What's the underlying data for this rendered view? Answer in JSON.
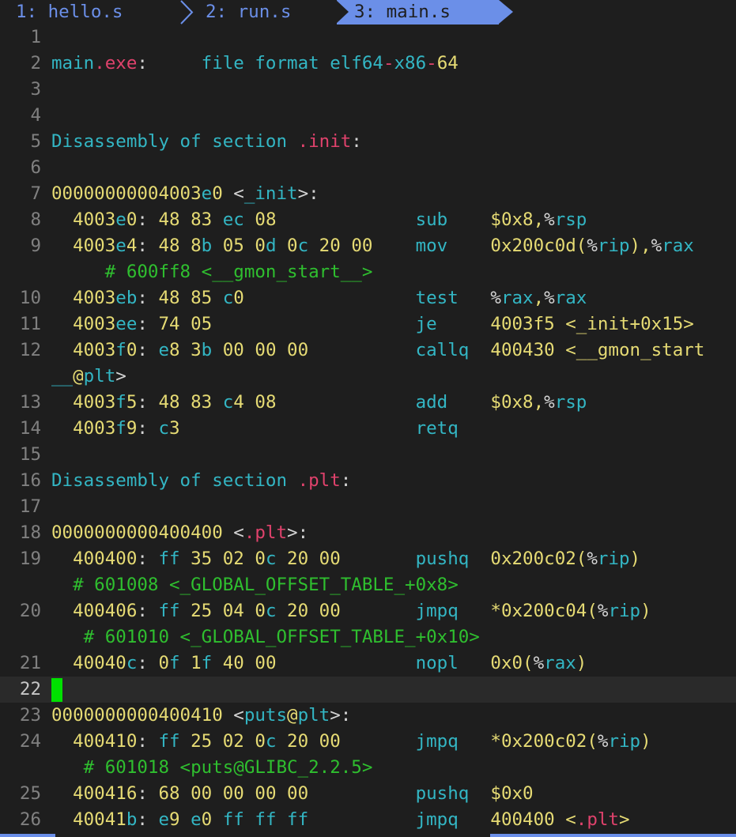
{
  "tabs": [
    {
      "label": "1: hello.s"
    },
    {
      "label": "2: run.s"
    },
    {
      "label": "3: main.s"
    }
  ],
  "colors": {
    "background": "#1e1e1e",
    "line_number": "#808080",
    "yellow": "#e6db74",
    "cyan": "#33b6c4",
    "red": "#e0426c",
    "green_comment": "#2fbf2f",
    "cursor": "#00e000",
    "tab_accent": "#6b8fe8"
  },
  "editor": {
    "current_line": "22",
    "lines": [
      {
        "n": "1",
        "text": ""
      },
      {
        "n": "2",
        "text": "main.exe:     file format elf64-x86-64"
      },
      {
        "n": "3",
        "text": ""
      },
      {
        "n": "4",
        "text": ""
      },
      {
        "n": "5",
        "text": "Disassembly of section .init:"
      },
      {
        "n": "6",
        "text": ""
      },
      {
        "n": "7",
        "text": "00000000004003e0 <_init>:"
      },
      {
        "n": "8",
        "text": "  4003e0: 48 83 ec 08             sub    $0x8,%rsp"
      },
      {
        "n": "9",
        "text": "  4003e4: 48 8b 05 0d 0c 20 00    mov    0x200c0d(%rip),%rax"
      },
      {
        "n": "",
        "text": "     # 600ff8 <__gmon_start__>"
      },
      {
        "n": "10",
        "text": "  4003eb: 48 85 c0                test   %rax,%rax"
      },
      {
        "n": "11",
        "text": "  4003ee: 74 05                   je     4003f5 <_init+0x15>"
      },
      {
        "n": "12",
        "text": "  4003f0: e8 3b 00 00 00          callq  400430 <__gmon_start"
      },
      {
        "n": "",
        "text": "__@plt>"
      },
      {
        "n": "13",
        "text": "  4003f5: 48 83 c4 08             add    $0x8,%rsp"
      },
      {
        "n": "14",
        "text": "  4003f9: c3                      retq"
      },
      {
        "n": "15",
        "text": ""
      },
      {
        "n": "16",
        "text": "Disassembly of section .plt:"
      },
      {
        "n": "17",
        "text": ""
      },
      {
        "n": "18",
        "text": "0000000000400400 <.plt>:"
      },
      {
        "n": "19",
        "text": "  400400: ff 35 02 0c 20 00       pushq  0x200c02(%rip)"
      },
      {
        "n": "",
        "text": "  # 601008 <_GLOBAL_OFFSET_TABLE_+0x8>"
      },
      {
        "n": "20",
        "text": "  400406: ff 25 04 0c 20 00       jmpq   *0x200c04(%rip)"
      },
      {
        "n": "",
        "text": "   # 601010 <_GLOBAL_OFFSET_TABLE_+0x10>"
      },
      {
        "n": "21",
        "text": "  40040c: 0f 1f 40 00             nopl   0x0(%rax)"
      },
      {
        "n": "22",
        "text": ""
      },
      {
        "n": "23",
        "text": "0000000000400410 <puts@plt>:"
      },
      {
        "n": "24",
        "text": "  400410: ff 25 02 0c 20 00       jmpq   *0x200c02(%rip)"
      },
      {
        "n": "",
        "text": "   # 601018 <puts@GLIBC_2.2.5>"
      },
      {
        "n": "25",
        "text": "  400416: 68 00 00 00 00          pushq  $0x0"
      },
      {
        "n": "26",
        "text": "  40041b: e9 e0 ff ff ff          jmpq   400400 <.plt>"
      }
    ]
  }
}
